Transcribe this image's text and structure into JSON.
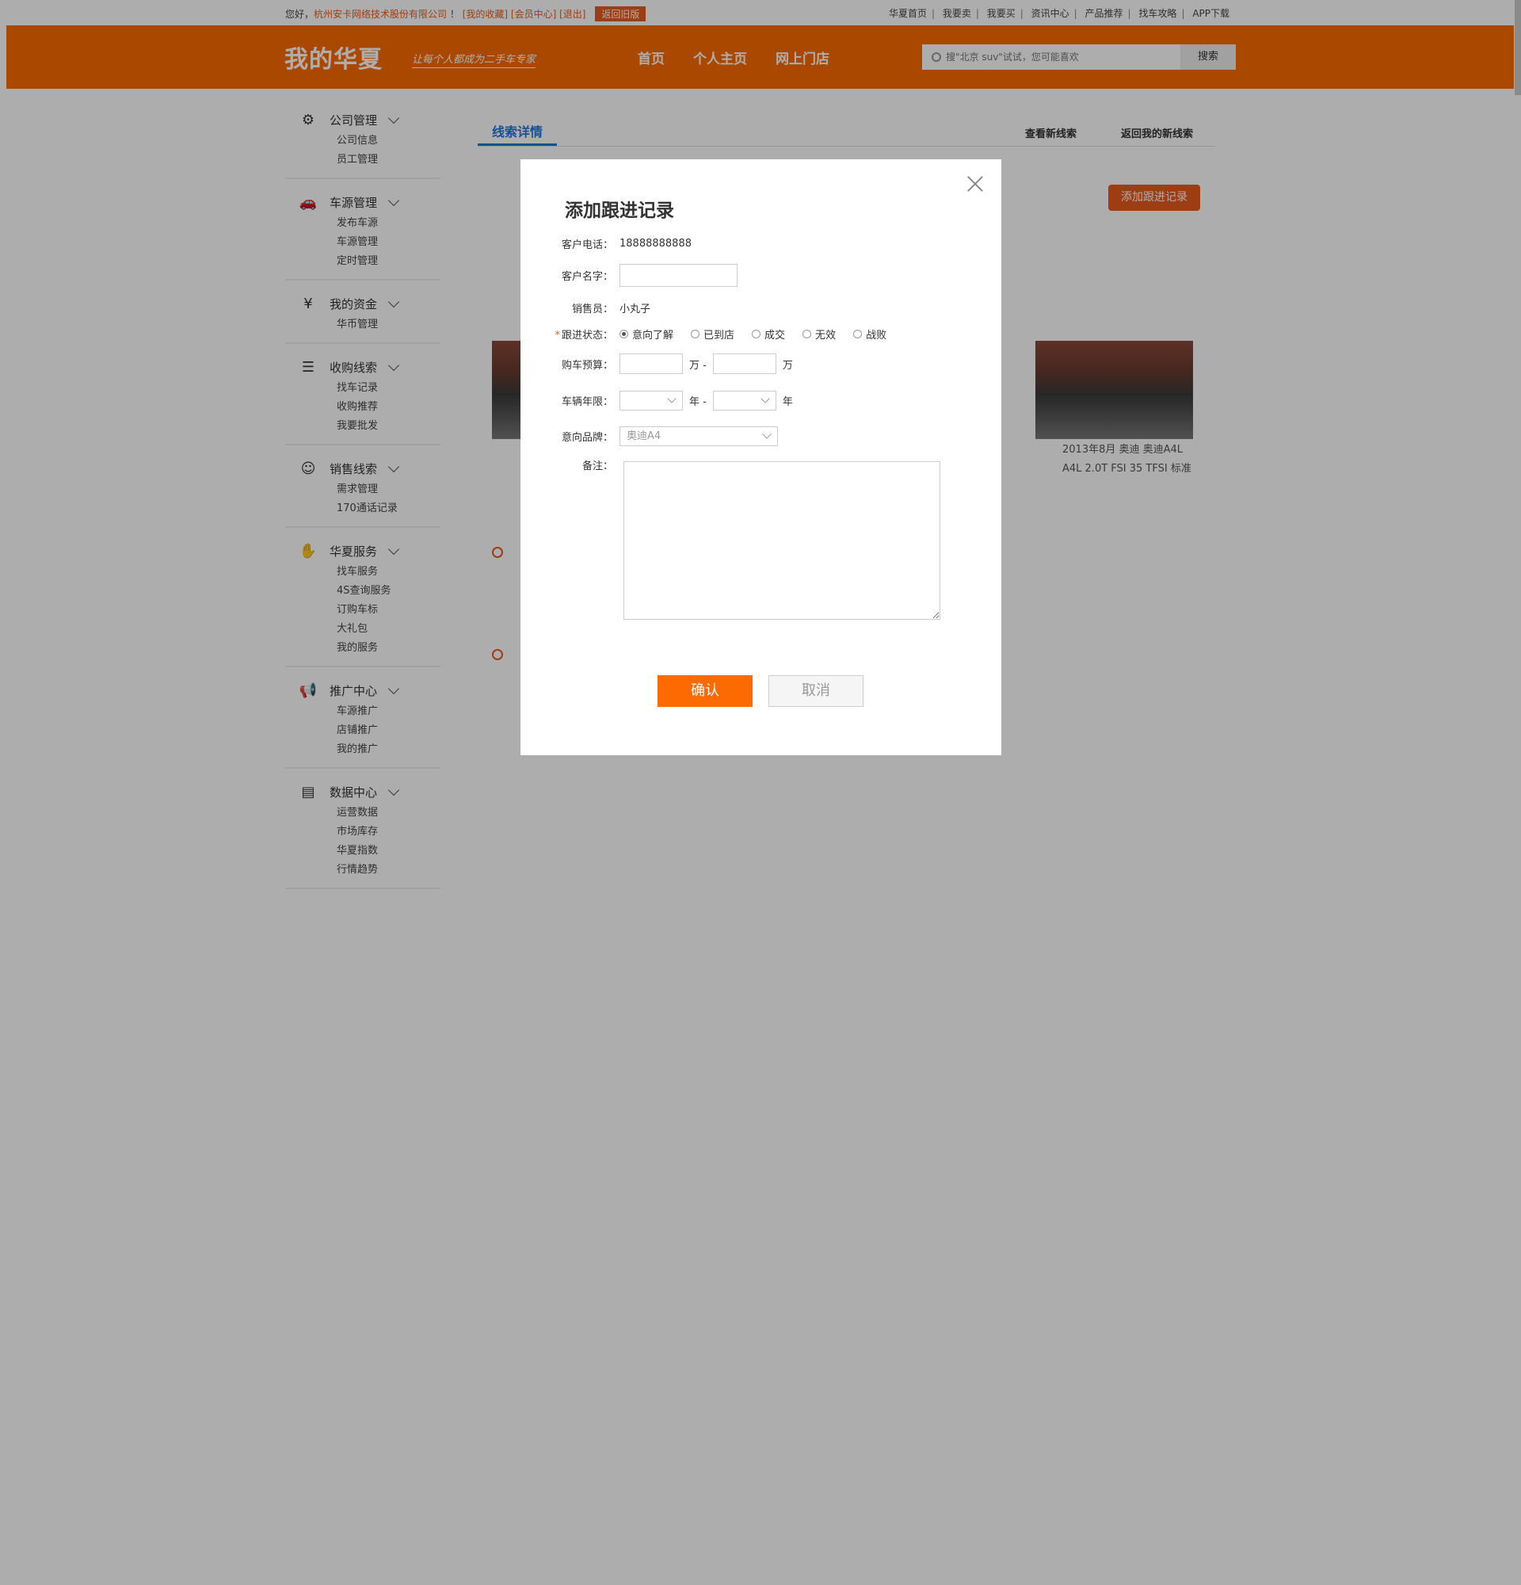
{
  "topbar": {
    "greeting": "您好，",
    "company": "杭州安卡网络技术股份有限公司",
    "exclaim": "！",
    "my_fav": "[我的收藏]",
    "member": "[会员中心]",
    "logout": "[退出]",
    "old_version": "返回旧版",
    "links": [
      "华夏首页",
      "我要卖",
      "我要买",
      "资讯中心",
      "产品推荐",
      "找车攻略",
      "APP下载"
    ]
  },
  "header": {
    "logo": "我的华夏",
    "slogan": "让每个人都成为二手车专家",
    "nav": [
      "首页",
      "个人主页",
      "网上门店"
    ],
    "search_placeholder": "搜\"北京 suv\"试试，您可能喜欢",
    "search_btn": "搜索"
  },
  "sidebar": [
    {
      "title": "公司管理",
      "icon": "user-gear-icon",
      "items": [
        "公司信息",
        "员工管理"
      ]
    },
    {
      "title": "车源管理",
      "icon": "car-gear-icon",
      "items": [
        "发布车源",
        "车源管理",
        "定时管理"
      ]
    },
    {
      "title": "我的资金",
      "icon": "money-bag-icon",
      "items": [
        "华币管理"
      ]
    },
    {
      "title": "收购线索",
      "icon": "document-search-icon",
      "items": [
        "找车记录",
        "收购推荐",
        "我要批发"
      ]
    },
    {
      "title": "销售线索",
      "icon": "agent-icon",
      "items": [
        "需求管理",
        "170通话记录"
      ]
    },
    {
      "title": "华夏服务",
      "icon": "handshake-icon",
      "items": [
        "找车服务",
        "4S查询服务",
        "订购车标",
        "大礼包",
        "我的服务"
      ]
    },
    {
      "title": "推广中心",
      "icon": "megaphone-icon",
      "items": [
        "车源推广",
        "店铺推广",
        "我的推广"
      ]
    },
    {
      "title": "数据中心",
      "icon": "inbox-icon",
      "items": [
        "运营数据",
        "市场库存",
        "华夏指数",
        "行情趋势"
      ]
    }
  ],
  "main": {
    "tab": "线索详情",
    "link_new": "查看新线索",
    "link_back": "返回我的新线索",
    "add_btn": "添加跟进记录",
    "cars": [
      {
        "line1": "2013年8月  奥迪 奥迪A4L",
        "line2": "A4L 2.0T FSI 35 TFSI 标准"
      },
      {
        "line1": "2013年8月  奥迪 奥迪A4L",
        "line2": "A4L 2.0T FSI 35 TFSI 标准"
      }
    ]
  },
  "modal": {
    "title": "添加跟进记录",
    "phone_label": "客户电话：",
    "phone": "18888888888",
    "name_label": "客户名字：",
    "sales_label": "销售员：",
    "sales": "小丸子",
    "status_label": "跟进状态：",
    "status_options": [
      "意向了解",
      "已到店",
      "成交",
      "无效",
      "战败"
    ],
    "budget_label": "购车预算：",
    "budget_unit": "万",
    "years_label": "车辆年限：",
    "years_unit": "年",
    "brand_label": "意向品牌：",
    "brand": "奥迪A4",
    "note_label": "备注：",
    "ok": "确认",
    "cancel": "取消"
  }
}
